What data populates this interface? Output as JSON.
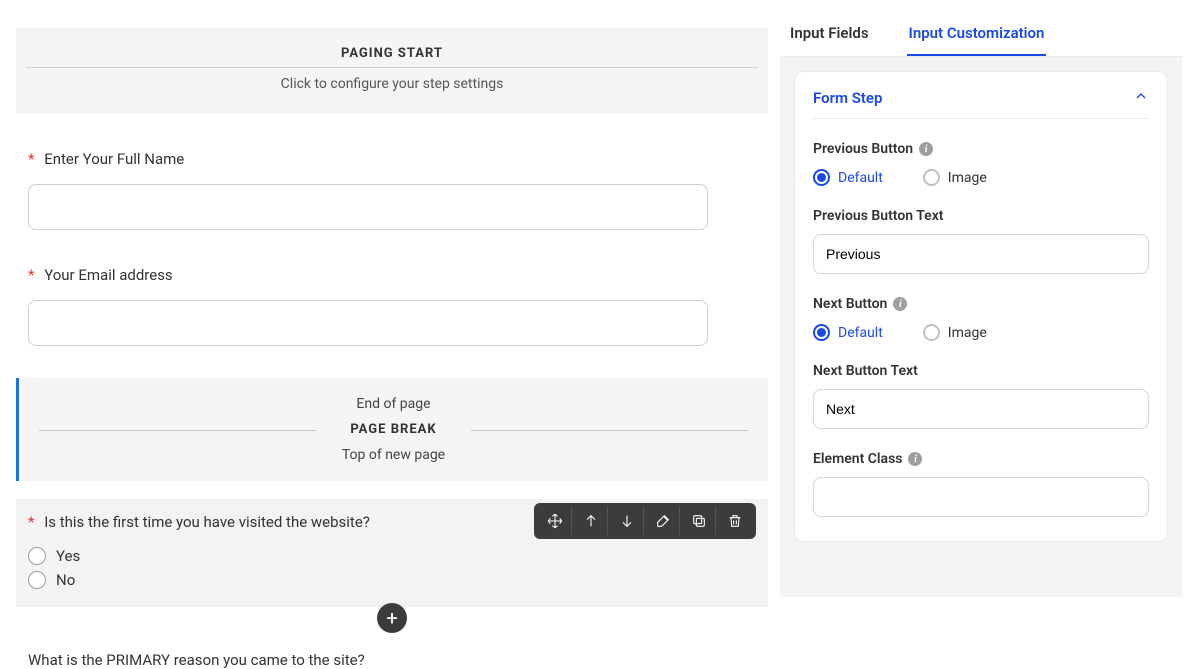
{
  "canvas": {
    "paging_start": {
      "title": "PAGING START",
      "subtitle": "Click to configure your step settings"
    },
    "field_name": {
      "label": "Enter Your Full Name"
    },
    "field_email": {
      "label": "Your Email address"
    },
    "page_break": {
      "end": "End of page",
      "title": "PAGE BREAK",
      "top": "Top of new page"
    },
    "field_first_visit": {
      "label": "Is this the first time you have visited the website?",
      "options": [
        "Yes",
        "No"
      ]
    },
    "field_primary_reason": {
      "label": "What is the PRIMARY reason you came to the site?"
    }
  },
  "sidebar": {
    "tabs": {
      "input_fields": "Input Fields",
      "input_customization": "Input Customization"
    },
    "accordion": {
      "title": "Form Step"
    },
    "prev_button": {
      "label": "Previous Button",
      "opt_default": "Default",
      "opt_image": "Image",
      "text_label": "Previous Button Text",
      "text_value": "Previous"
    },
    "next_button": {
      "label": "Next Button",
      "opt_default": "Default",
      "opt_image": "Image",
      "text_label": "Next Button Text",
      "text_value": "Next"
    },
    "element_class": {
      "label": "Element Class"
    }
  }
}
